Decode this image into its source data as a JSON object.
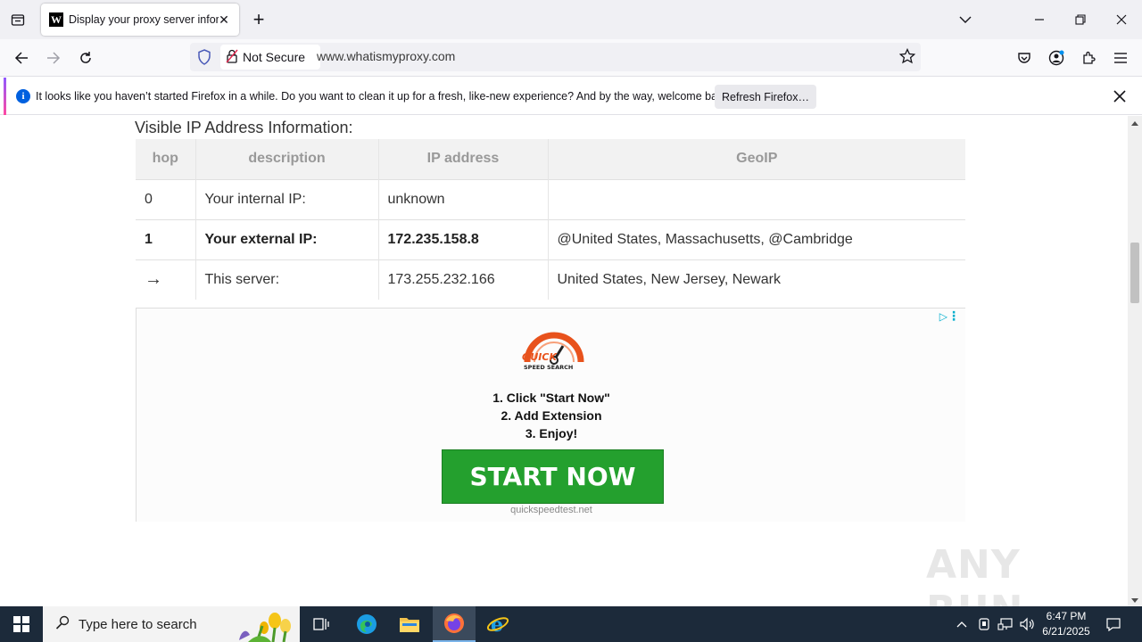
{
  "browser": {
    "tab": {
      "title": "Display your proxy server inform",
      "favicon_letter": "W"
    },
    "identity_label": "Not Secure",
    "url": "www.whatismyproxy.com"
  },
  "notification": {
    "message": "It looks like you haven’t started Firefox in a while. Do you want to clean it up for a fresh, like-new experience? And by the way, welcome back!",
    "button_label": "Refresh Firefox…"
  },
  "page": {
    "section_title": "Visible IP Address Information:",
    "table": {
      "headers": [
        "hop",
        "description",
        "IP address",
        "GeoIP"
      ],
      "rows": [
        [
          "0",
          "Your internal IP:",
          "unknown",
          ""
        ],
        [
          "1",
          "Your external IP:",
          "172.235.158.8",
          "@United States, Massachusetts, @Cambridge"
        ],
        [
          "→",
          "This server:",
          "173.255.232.166",
          "United States, New Jersey, Newark"
        ]
      ]
    },
    "ad": {
      "logo_text": "QUICK SPEED SEARCH",
      "steps": [
        "1. Click \"Start Now\"",
        "2. Add Extension",
        "3. Enjoy!"
      ],
      "cta_label": "START NOW",
      "domain": "quickspeedtest.net"
    },
    "watermark": "ANY RUN"
  },
  "taskbar": {
    "search_placeholder": "Type here to search",
    "time": "6:47 PM",
    "date": "6/21/2025"
  },
  "colors": {
    "cta_green": "#24a02e",
    "firefox_accent": "#0060df",
    "taskbar_bg": "#1c2a3a"
  }
}
